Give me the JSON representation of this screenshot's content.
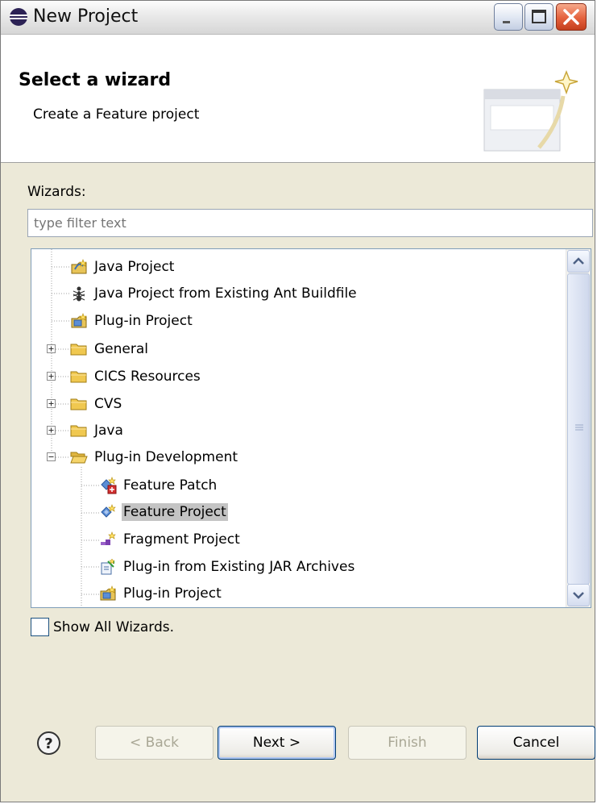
{
  "window": {
    "title": "New Project"
  },
  "banner": {
    "title": "Select a wizard",
    "subtitle": "Create a Feature project"
  },
  "wizards_label": "Wizards:",
  "filter": {
    "value": "",
    "placeholder": "type filter text"
  },
  "tree": {
    "items": [
      {
        "label": "Java Project",
        "icon": "java-project-icon",
        "expander": "none"
      },
      {
        "label": "Java Project from Existing Ant Buildfile",
        "icon": "ant-icon",
        "expander": "none"
      },
      {
        "label": "Plug-in Project",
        "icon": "plugin-project-icon",
        "expander": "none"
      },
      {
        "label": "General",
        "icon": "folder-icon",
        "expander": "plus"
      },
      {
        "label": "CICS Resources",
        "icon": "folder-icon",
        "expander": "plus"
      },
      {
        "label": "CVS",
        "icon": "folder-icon",
        "expander": "plus"
      },
      {
        "label": "Java",
        "icon": "folder-icon",
        "expander": "plus"
      },
      {
        "label": "Plug-in Development",
        "icon": "folder-open-icon",
        "expander": "minus"
      },
      {
        "label": "Feature Patch",
        "icon": "feature-patch-icon",
        "expander": "none"
      },
      {
        "label": "Feature Project",
        "icon": "feature-project-icon",
        "expander": "none",
        "selected": true
      },
      {
        "label": "Fragment Project",
        "icon": "fragment-project-icon",
        "expander": "none"
      },
      {
        "label": "Plug-in from Existing JAR Archives",
        "icon": "jar-plugin-icon",
        "expander": "none"
      },
      {
        "label": "Plug-in Project",
        "icon": "plugin-project-icon",
        "expander": "none"
      }
    ]
  },
  "show_all": {
    "label": "Show All Wizards.",
    "checked": false
  },
  "buttons": {
    "back": "< Back",
    "next": "Next >",
    "finish": "Finish",
    "cancel": "Cancel"
  },
  "colors": {
    "selection": "#c4c4c4",
    "dialog_bg": "#ece9d8",
    "folder": "#f0c850"
  }
}
